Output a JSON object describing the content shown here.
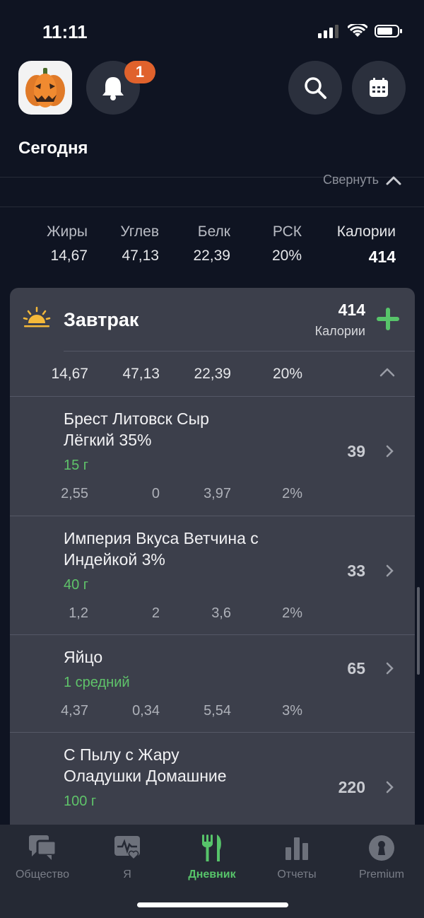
{
  "status": {
    "time": "11:11"
  },
  "header": {
    "title": "Сегодня",
    "notification_count": "1"
  },
  "collapse_label": "Свернуть",
  "totals": {
    "labels": [
      "Жиры",
      "Углев",
      "Белк",
      "РСК",
      "Калории"
    ],
    "values": [
      "14,67",
      "47,13",
      "22,39",
      "20%",
      "414"
    ]
  },
  "meal": {
    "name": "Завтрак",
    "calories": "414",
    "calories_unit": "Калории",
    "macros": [
      "14,67",
      "47,13",
      "22,39",
      "20%"
    ],
    "items": [
      {
        "name_line1": "Брест Литовск Сыр",
        "name_line2": "Лёгкий 35%",
        "portion": "15 г",
        "calories": "39",
        "macros": [
          "2,55",
          "0",
          "3,97",
          "2%"
        ]
      },
      {
        "name_line1": "Империя Вкуса Ветчина с",
        "name_line2": "Индейкой 3%",
        "portion": "40 г",
        "calories": "33",
        "macros": [
          "1,2",
          "2",
          "3,6",
          "2%"
        ]
      },
      {
        "name_line1": "Яйцо",
        "name_line2": "",
        "portion": "1 средний",
        "calories": "65",
        "macros": [
          "4,37",
          "0,34",
          "5,54",
          "3%"
        ]
      },
      {
        "name_line1": "С Пылу с Жару",
        "name_line2": "Оладушки Домашние",
        "portion": "100 г",
        "calories": "220",
        "macros": [
          "",
          "",
          "",
          ""
        ]
      }
    ]
  },
  "tabs": [
    {
      "label": "Общество",
      "icon": "chat-icon"
    },
    {
      "label": "Я",
      "icon": "health-icon"
    },
    {
      "label": "Дневник",
      "icon": "fork-knife-icon",
      "active": true
    },
    {
      "label": "Отчеты",
      "icon": "bar-chart-icon"
    },
    {
      "label": "Premium",
      "icon": "keyhole-icon"
    }
  ],
  "colors": {
    "accent": "#57c46a",
    "badge": "#e0622c",
    "background": "#0f1422",
    "card": "#3c3f4b"
  }
}
